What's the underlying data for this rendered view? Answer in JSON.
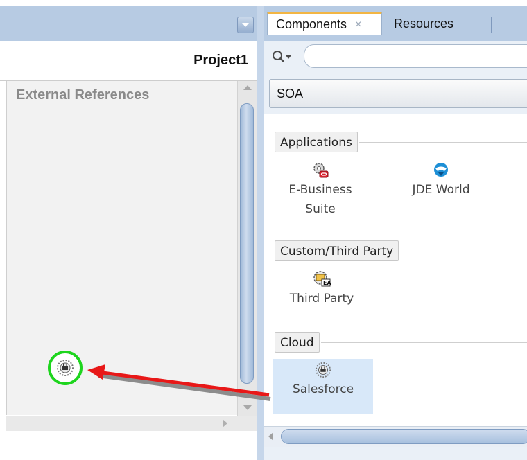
{
  "left_panel": {
    "project_title": "Project1",
    "canvas_label": "External References",
    "dropped_icon": "salesforce-icon"
  },
  "right_panel": {
    "tabs": [
      {
        "label": "Components",
        "active": true,
        "close": "×"
      },
      {
        "label": "Resources",
        "active": false
      }
    ],
    "search": {
      "value": "",
      "placeholder": ""
    },
    "category": "SOA",
    "sections": {
      "applications": {
        "label": "Applications",
        "items": [
          {
            "label_line1": "E-Business",
            "label_line2": "Suite",
            "icon": "ebusiness-suite-icon"
          },
          {
            "label": "JDE World",
            "icon": "jde-world-icon"
          }
        ]
      },
      "custom": {
        "label": "Custom/Third Party",
        "items": [
          {
            "label": "Third Party",
            "icon": "third-party-icon"
          }
        ]
      },
      "cloud": {
        "label": "Cloud",
        "items": [
          {
            "label": "Salesforce",
            "icon": "salesforce-icon",
            "selected": true
          }
        ]
      }
    }
  },
  "annotations": {
    "highlight_color": "#1ed51e",
    "arrow_color": "#e81818",
    "arrow_shadow_color": "#8c8c8c"
  }
}
